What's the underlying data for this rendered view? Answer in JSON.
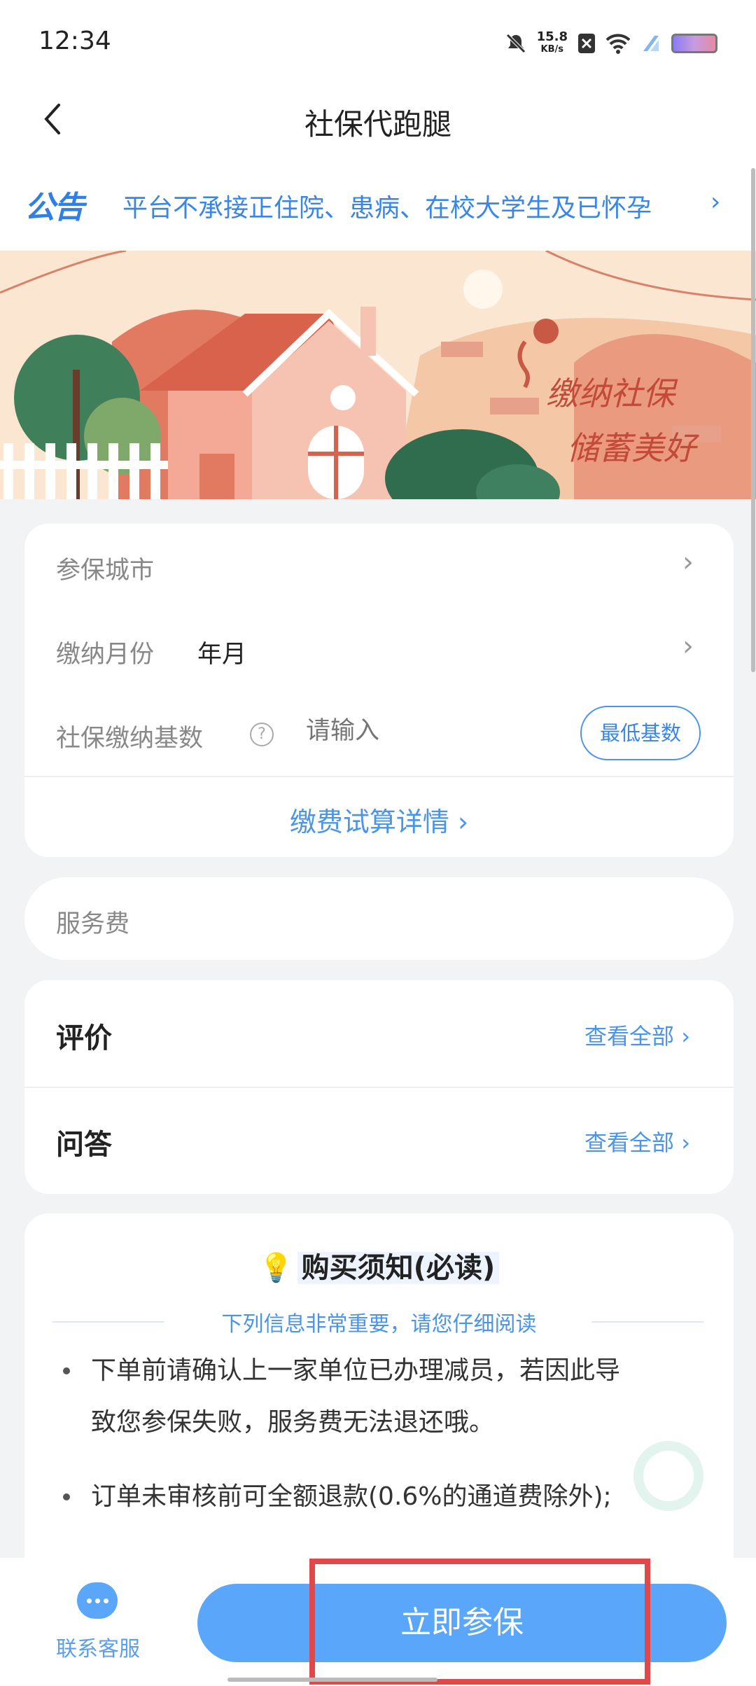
{
  "status_bar": {
    "time": "12:34",
    "speed_value": "15.8",
    "speed_unit": "KB/s"
  },
  "header": {
    "title": "社保代跑腿"
  },
  "notice": {
    "tag": "公告",
    "text": "平台不承接正住院、患病、在校大学生及已怀孕"
  },
  "banner": {
    "line1": "缴纳社保",
    "line2": "储蓄美好"
  },
  "calc_form": {
    "city_label": "参保城市",
    "month_label": "缴纳月份",
    "month_value": "年月",
    "base_label": "社保缴纳基数",
    "base_placeholder": "请输入",
    "min_base_button": "最低基数",
    "details_link": "缴费试算详情"
  },
  "fee": {
    "label": "服务费"
  },
  "reviews": {
    "title": "评价",
    "view_all": "查看全部"
  },
  "qa": {
    "title": "问答",
    "view_all": "查看全部"
  },
  "purchase_notice": {
    "title": "购买须知(必读)",
    "subtitle": "下列信息非常重要，请您仔细阅读",
    "item1_line1": "下单前请确认上一家单位已办理减员，若因此导",
    "item1_line2": "致您参保失败，服务费无法退还哦。",
    "item2_line1": "订单未审核前可全额退款(0.6%的通道费除外);"
  },
  "bottom_bar": {
    "service_label": "联系客服",
    "buy_button": "立即参保"
  },
  "colors": {
    "accent": "#3a86e8",
    "button": "#5aa6fb",
    "highlight": "#e0484a"
  }
}
